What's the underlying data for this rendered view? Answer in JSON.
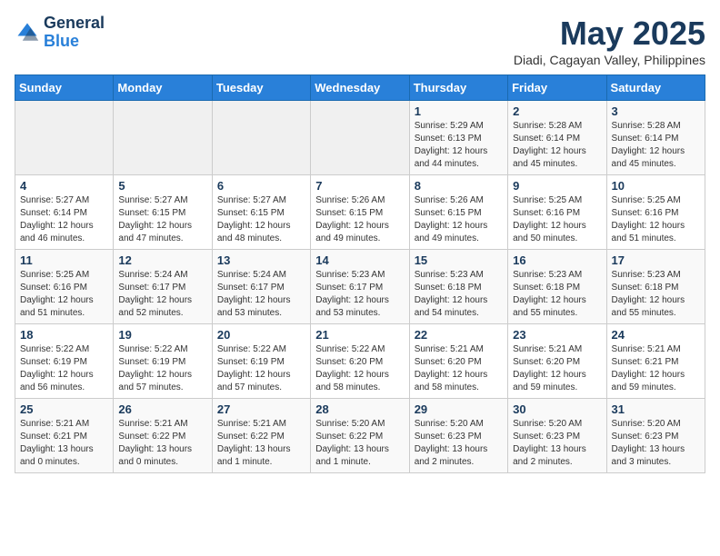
{
  "header": {
    "logo_line1": "General",
    "logo_line2": "Blue",
    "month": "May 2025",
    "location": "Diadi, Cagayan Valley, Philippines"
  },
  "days_of_week": [
    "Sunday",
    "Monday",
    "Tuesday",
    "Wednesday",
    "Thursday",
    "Friday",
    "Saturday"
  ],
  "weeks": [
    [
      {
        "num": "",
        "info": ""
      },
      {
        "num": "",
        "info": ""
      },
      {
        "num": "",
        "info": ""
      },
      {
        "num": "",
        "info": ""
      },
      {
        "num": "1",
        "info": "Sunrise: 5:29 AM\nSunset: 6:13 PM\nDaylight: 12 hours\nand 44 minutes."
      },
      {
        "num": "2",
        "info": "Sunrise: 5:28 AM\nSunset: 6:14 PM\nDaylight: 12 hours\nand 45 minutes."
      },
      {
        "num": "3",
        "info": "Sunrise: 5:28 AM\nSunset: 6:14 PM\nDaylight: 12 hours\nand 45 minutes."
      }
    ],
    [
      {
        "num": "4",
        "info": "Sunrise: 5:27 AM\nSunset: 6:14 PM\nDaylight: 12 hours\nand 46 minutes."
      },
      {
        "num": "5",
        "info": "Sunrise: 5:27 AM\nSunset: 6:15 PM\nDaylight: 12 hours\nand 47 minutes."
      },
      {
        "num": "6",
        "info": "Sunrise: 5:27 AM\nSunset: 6:15 PM\nDaylight: 12 hours\nand 48 minutes."
      },
      {
        "num": "7",
        "info": "Sunrise: 5:26 AM\nSunset: 6:15 PM\nDaylight: 12 hours\nand 49 minutes."
      },
      {
        "num": "8",
        "info": "Sunrise: 5:26 AM\nSunset: 6:15 PM\nDaylight: 12 hours\nand 49 minutes."
      },
      {
        "num": "9",
        "info": "Sunrise: 5:25 AM\nSunset: 6:16 PM\nDaylight: 12 hours\nand 50 minutes."
      },
      {
        "num": "10",
        "info": "Sunrise: 5:25 AM\nSunset: 6:16 PM\nDaylight: 12 hours\nand 51 minutes."
      }
    ],
    [
      {
        "num": "11",
        "info": "Sunrise: 5:25 AM\nSunset: 6:16 PM\nDaylight: 12 hours\nand 51 minutes."
      },
      {
        "num": "12",
        "info": "Sunrise: 5:24 AM\nSunset: 6:17 PM\nDaylight: 12 hours\nand 52 minutes."
      },
      {
        "num": "13",
        "info": "Sunrise: 5:24 AM\nSunset: 6:17 PM\nDaylight: 12 hours\nand 53 minutes."
      },
      {
        "num": "14",
        "info": "Sunrise: 5:23 AM\nSunset: 6:17 PM\nDaylight: 12 hours\nand 53 minutes."
      },
      {
        "num": "15",
        "info": "Sunrise: 5:23 AM\nSunset: 6:18 PM\nDaylight: 12 hours\nand 54 minutes."
      },
      {
        "num": "16",
        "info": "Sunrise: 5:23 AM\nSunset: 6:18 PM\nDaylight: 12 hours\nand 55 minutes."
      },
      {
        "num": "17",
        "info": "Sunrise: 5:23 AM\nSunset: 6:18 PM\nDaylight: 12 hours\nand 55 minutes."
      }
    ],
    [
      {
        "num": "18",
        "info": "Sunrise: 5:22 AM\nSunset: 6:19 PM\nDaylight: 12 hours\nand 56 minutes."
      },
      {
        "num": "19",
        "info": "Sunrise: 5:22 AM\nSunset: 6:19 PM\nDaylight: 12 hours\nand 57 minutes."
      },
      {
        "num": "20",
        "info": "Sunrise: 5:22 AM\nSunset: 6:19 PM\nDaylight: 12 hours\nand 57 minutes."
      },
      {
        "num": "21",
        "info": "Sunrise: 5:22 AM\nSunset: 6:20 PM\nDaylight: 12 hours\nand 58 minutes."
      },
      {
        "num": "22",
        "info": "Sunrise: 5:21 AM\nSunset: 6:20 PM\nDaylight: 12 hours\nand 58 minutes."
      },
      {
        "num": "23",
        "info": "Sunrise: 5:21 AM\nSunset: 6:20 PM\nDaylight: 12 hours\nand 59 minutes."
      },
      {
        "num": "24",
        "info": "Sunrise: 5:21 AM\nSunset: 6:21 PM\nDaylight: 12 hours\nand 59 minutes."
      }
    ],
    [
      {
        "num": "25",
        "info": "Sunrise: 5:21 AM\nSunset: 6:21 PM\nDaylight: 13 hours\nand 0 minutes."
      },
      {
        "num": "26",
        "info": "Sunrise: 5:21 AM\nSunset: 6:22 PM\nDaylight: 13 hours\nand 0 minutes."
      },
      {
        "num": "27",
        "info": "Sunrise: 5:21 AM\nSunset: 6:22 PM\nDaylight: 13 hours\nand 1 minute."
      },
      {
        "num": "28",
        "info": "Sunrise: 5:20 AM\nSunset: 6:22 PM\nDaylight: 13 hours\nand 1 minute."
      },
      {
        "num": "29",
        "info": "Sunrise: 5:20 AM\nSunset: 6:23 PM\nDaylight: 13 hours\nand 2 minutes."
      },
      {
        "num": "30",
        "info": "Sunrise: 5:20 AM\nSunset: 6:23 PM\nDaylight: 13 hours\nand 2 minutes."
      },
      {
        "num": "31",
        "info": "Sunrise: 5:20 AM\nSunset: 6:23 PM\nDaylight: 13 hours\nand 3 minutes."
      }
    ]
  ]
}
